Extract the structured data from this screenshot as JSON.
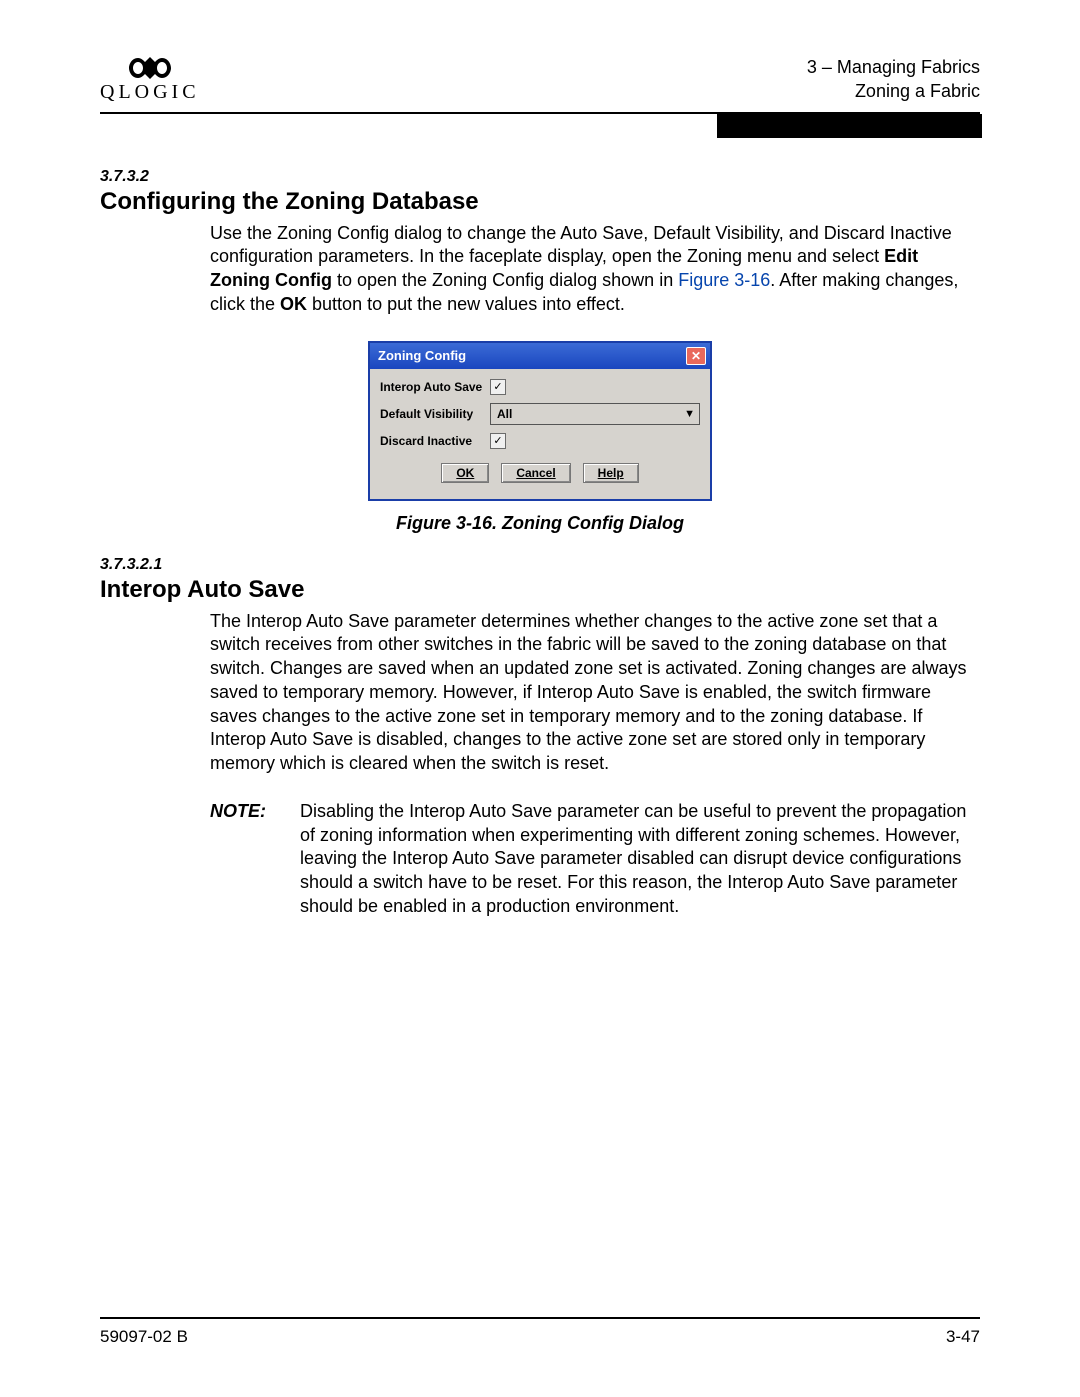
{
  "header": {
    "logo_text": "QLOGIC",
    "chapter": "3 – Managing Fabrics",
    "section": "Zoning a Fabric"
  },
  "sec1": {
    "num": "3.7.3.2",
    "title": "Configuring the Zoning Database",
    "p1a": "Use the Zoning Config dialog to change the Auto Save, Default Visibility, and Discard Inactive configuration parameters. In the faceplate display, open the Zoning menu and select ",
    "p1_bold1": "Edit Zoning Config",
    "p1b": " to open the Zoning Config dialog shown in ",
    "p1_link": "Figure 3-16",
    "p1c": ". After making changes, click the ",
    "p1_bold2": "OK",
    "p1d": " button to put the new values into effect."
  },
  "dialog": {
    "title": "Zoning Config",
    "row1_label": "Interop Auto Save",
    "row1_checked": "✓",
    "row2_label": "Default Visibility",
    "row2_value": "All",
    "row3_label": "Discard Inactive",
    "row3_checked": "✓",
    "ok": "OK",
    "cancel": "Cancel",
    "help": "Help"
  },
  "figcap": "Figure 3-16.  Zoning Config Dialog",
  "sec2": {
    "num": "3.7.3.2.1",
    "title": "Interop Auto Save",
    "p1": "The Interop Auto Save parameter determines whether changes to the active zone set that a switch receives from other switches in the fabric will be saved to the zoning database on that switch. Changes are saved when an updated zone set is activated. Zoning changes are always saved to temporary memory. However, if Interop Auto Save is enabled, the switch firmware saves changes to the active zone set in temporary memory and to the zoning database. If Interop Auto Save is disabled, changes to the active zone set are stored only in temporary memory which is cleared when the switch is reset."
  },
  "note": {
    "label": "NOTE:",
    "text": "Disabling the Interop Auto Save parameter can be useful to prevent the propagation of zoning information when experimenting with different zoning schemes. However, leaving the Interop Auto Save parameter disabled can disrupt device configurations should a switch have to be reset. For this reason, the Interop Auto Save parameter should be enabled in a production environment."
  },
  "footer": {
    "left": "59097-02 B",
    "right": "3-47"
  }
}
